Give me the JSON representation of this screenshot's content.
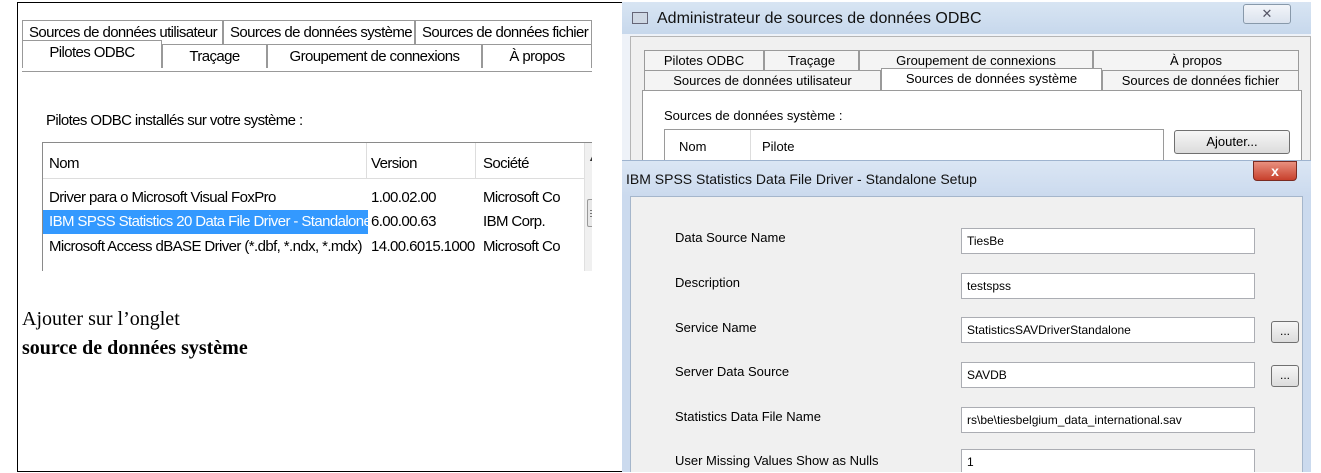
{
  "left": {
    "tabs_row1": [
      "Sources de données utilisateur",
      "Sources de données système",
      "Sources de données fichier"
    ],
    "tabs_row2": [
      "Pilotes ODBC",
      "Traçage",
      "Groupement de connexions",
      "À propos"
    ],
    "installed_label": "Pilotes ODBC installés sur votre système :",
    "columns": [
      "Nom",
      "Version",
      "Société"
    ],
    "drivers": [
      {
        "name": "Driver para o Microsoft Visual FoxPro",
        "version": "1.00.02.00",
        "company": "Microsoft Co"
      },
      {
        "name": "IBM SPSS Statistics 20 Data File Driver - Standalone",
        "version": "6.00.00.63",
        "company": "IBM Corp."
      },
      {
        "name": "Microsoft Access dBASE Driver (*.dbf, *.ndx, *.mdx)",
        "version": "14.00.6015.1000",
        "company": "Microsoft Co"
      }
    ],
    "instruction_line1": "Ajouter sur l’onglet",
    "instruction_line2": "source de données système"
  },
  "right": {
    "admin_window": {
      "title": "Administrateur de sources de données ODBC",
      "close_label": "✕",
      "tabs_row1": [
        "Pilotes ODBC",
        "Traçage",
        "Groupement de connexions",
        "À propos"
      ],
      "tabs_row2": [
        "Sources de données utilisateur",
        "Sources de données système",
        "Sources de données fichier"
      ],
      "system_sources_label": "Sources de données système :",
      "columns": [
        "Nom",
        "Pilote"
      ],
      "add_button": "Ajouter..."
    },
    "setup_dialog": {
      "title": "IBM SPSS Statistics Data File Driver - Standalone Setup",
      "close_label": "x",
      "browse_label": "...",
      "fields": [
        {
          "label": "Data Source Name",
          "value": "TiesBe"
        },
        {
          "label": "Description",
          "value": "testspss"
        },
        {
          "label": "Service Name",
          "value": "StatisticsSAVDriverStandalone"
        },
        {
          "label": "Server Data Source",
          "value": "SAVDB"
        },
        {
          "label": "Statistics Data File Name",
          "value": "rs\\be\\tiesbelgium_data_international.sav"
        },
        {
          "label": "User Missing Values Show as Nulls",
          "value": "1"
        }
      ]
    }
  },
  "colors": {
    "selection": "#3399ff",
    "close_red": "#c7402c",
    "title_blue": "#cbdaee"
  }
}
